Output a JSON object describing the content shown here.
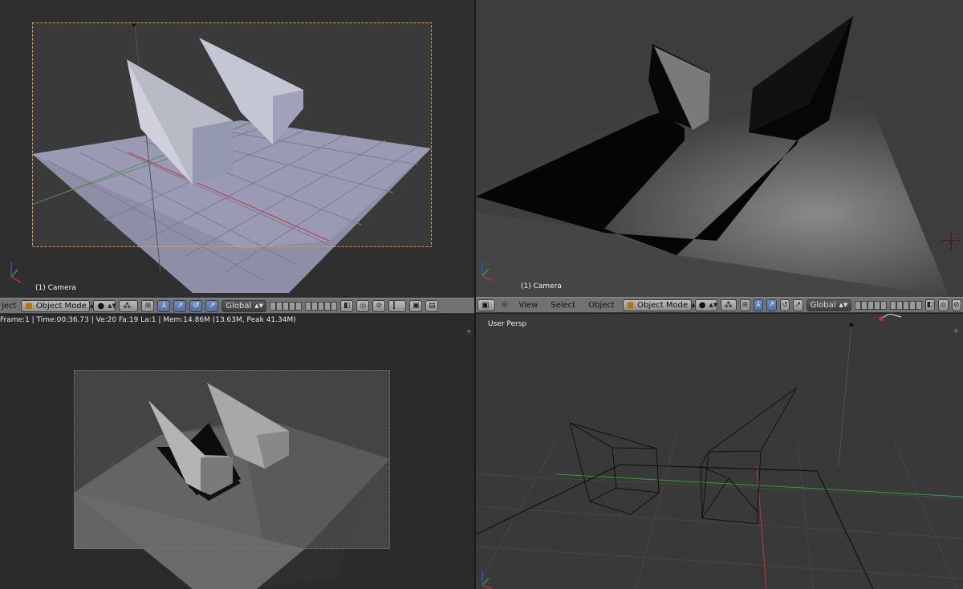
{
  "viewports": {
    "top_left": {
      "label": "(1) Camera"
    },
    "top_right": {
      "label": "(1) Camera"
    },
    "bottom_right": {
      "label": "User Persp"
    }
  },
  "header_left": {
    "menu_partial": "ject",
    "mode": "Object Mode",
    "orientation": "Global"
  },
  "header_right": {
    "menu_view": "View",
    "menu_select": "Select",
    "menu_object": "Object",
    "mode": "Object Mode",
    "orientation": "Global"
  },
  "status_bar": {
    "text": "Frame:1 | Time:00:36.73 | Ve:20 Fa:19 La:1 | Mem:14.86M (13.63M, Peak 41.34M)"
  },
  "axis_labels": {
    "x": "x",
    "y": "y",
    "z": "z"
  },
  "icons": [
    "object-mode-cube-icon",
    "viewport-shading-icon",
    "pivot-icon",
    "manipulator-icon",
    "layers-icon",
    "render-icon",
    "snap-icon",
    "proportional-edit-icon"
  ],
  "colors": {
    "header_bg": "#727272",
    "viewport_bg": "#393939",
    "camera_frame": "#e8a040",
    "x_axis": "#c03030",
    "y_axis": "#30a030",
    "z_axis": "#3050c0"
  }
}
